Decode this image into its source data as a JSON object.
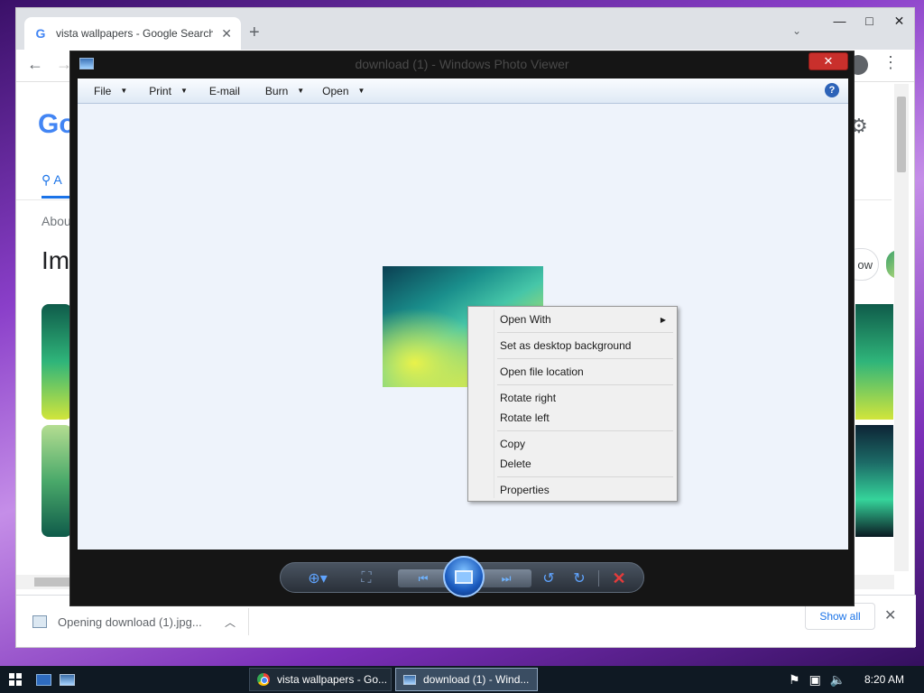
{
  "browser": {
    "tab_title": "vista wallpapers - Google Search",
    "tab_favicon": "G",
    "tab_close": "✕",
    "new_tab": "+",
    "tab_search": "⌄",
    "window_minimize": "—",
    "window_maximize": "□",
    "window_close": "✕",
    "back": "←",
    "forward": "→",
    "menu": "⋮",
    "page": {
      "logo_fragment": "Go",
      "search_tab_fragment": "A",
      "about_fragment": "Abou",
      "images_heading_fragment": "Im",
      "related_chip_fragment": "ow"
    },
    "download_bar": {
      "item_text": "Opening download (1).jpg...",
      "show_all": "Show all",
      "close": "✕"
    }
  },
  "photo_viewer": {
    "title": "download (1) - Windows Photo Viewer",
    "close": "✕",
    "menu": [
      {
        "label": "File",
        "has_dropdown": true
      },
      {
        "label": "Print",
        "has_dropdown": true
      },
      {
        "label": "E-mail",
        "has_dropdown": false
      },
      {
        "label": "Burn",
        "has_dropdown": true
      },
      {
        "label": "Open",
        "has_dropdown": true
      }
    ],
    "help": "?",
    "context_menu": {
      "open_with": "Open With",
      "set_desktop_background": "Set as desktop background",
      "open_file_location": "Open file location",
      "rotate_right": "Rotate right",
      "rotate_left": "Rotate left",
      "copy": "Copy",
      "delete": "Delete",
      "properties": "Properties"
    }
  },
  "taskbar": {
    "task_chrome": "vista wallpapers - Go...",
    "task_photo_viewer": "download (1) - Wind...",
    "clock": "8:20 AM"
  },
  "colors": {
    "accent_blue": "#1a73e8",
    "viewer_close_red": "#c9302c",
    "delete_red": "#e53b3b"
  }
}
